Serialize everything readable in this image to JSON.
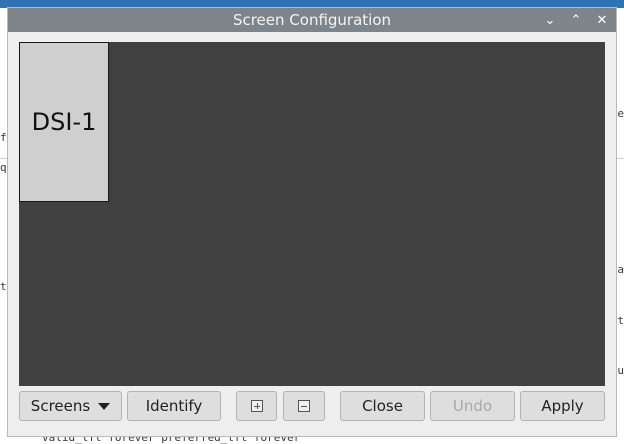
{
  "background_terminal": {
    "bottom_line": "valid_lft forever preferred_lft forever",
    "left_fragments": [
      "fil",
      "q",
      "t"
    ],
    "right_fragments": [
      "e",
      "fa",
      "t",
      "ou"
    ]
  },
  "dialog": {
    "title": "Screen Configuration",
    "window_controls": {
      "minimize": "⌄",
      "maximize": "⌃",
      "close": "✕"
    },
    "monitor_label": "DSI-1",
    "buttons": {
      "screens": "Screens",
      "identify": "Identify",
      "close": "Close",
      "undo": "Undo",
      "apply": "Apply"
    }
  },
  "colors": {
    "titlebar": "#7e858a",
    "canvas": "#404040",
    "monitor": "#cfcfcf"
  }
}
